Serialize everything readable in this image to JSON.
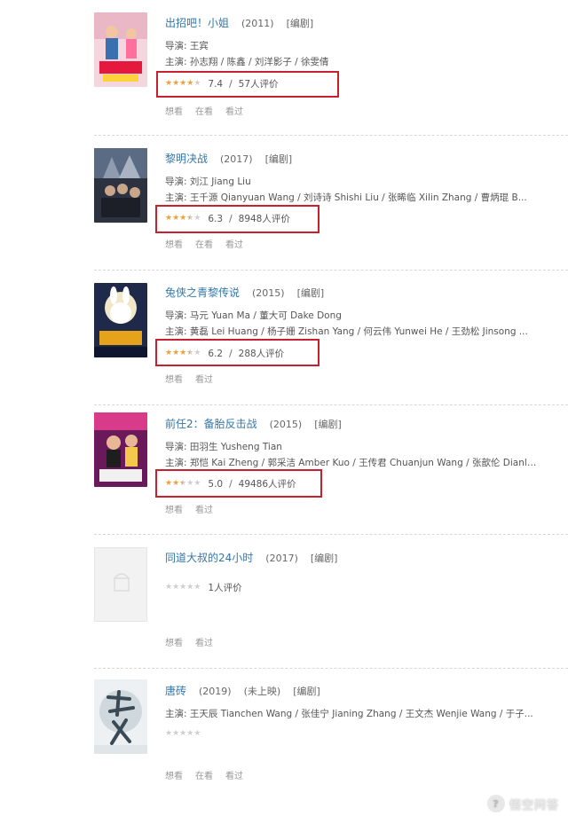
{
  "labels": {
    "director": "导演:",
    "cast": "主演:",
    "edit": "[编剧]",
    "separator": "/"
  },
  "movies": [
    {
      "title": "出招吧！小姐",
      "year": "(2011)",
      "director": "王宾",
      "cast": "孙志翔 / 陈鑫 / 刘洋影子 / 徐雯倩",
      "score": "7.4",
      "votes": "57人评价",
      "actions": [
        "想看",
        "在看",
        "看过"
      ],
      "stars": 4
    },
    {
      "title": "黎明决战",
      "year": "(2017)",
      "director": "刘江 Jiang Liu",
      "cast": "王千源 Qianyuan Wang / 刘诗诗 Shishi Liu / 张晞临 Xilin Zhang / 曹炳琨 B...",
      "score": "6.3",
      "votes": "8948人评价",
      "actions": [
        "想看",
        "在看",
        "看过"
      ],
      "stars": 3.5
    },
    {
      "title": "兔侠之青黎传说",
      "year": "(2015)",
      "director": "马元 Yuan Ma / 董大可 Dake Dong",
      "cast": "黄磊 Lei Huang / 杨子姗 Zishan Yang / 何云伟 Yunwei He / 王劲松 Jinsong ...",
      "score": "6.2",
      "votes": "288人评价",
      "actions": [
        "想看",
        "看过"
      ],
      "stars": 3.5
    },
    {
      "title": "前任2：备胎反击战",
      "year": "(2015)",
      "director": "田羽生 Yusheng Tian",
      "cast": "郑恺 Kai Zheng / 郭采洁 Amber Kuo / 王传君 Chuanjun Wang / 张歆伦 Dianlu...",
      "score": "5.0",
      "votes": "49486人评价",
      "actions": [
        "想看",
        "看过"
      ],
      "stars": 2.5
    },
    {
      "title": "同道大叔的24小时",
      "year": "(2017)",
      "votes": "1人评价",
      "actions": [
        "想看",
        "看过"
      ],
      "stars": 0
    },
    {
      "title": "唐砖",
      "year": "(2019)",
      "status": "(未上映)",
      "cast": "王天辰 Tianchen Wang / 张佳宁 Jianing Zhang / 王文杰 Wenjie Wang / 于子...",
      "actions": [
        "想看",
        "在看",
        "看过"
      ],
      "stars": 0
    }
  ],
  "watermark": {
    "text": "悟空问答"
  },
  "colors": {
    "link": "#3377aa",
    "star": "#f2a13a",
    "highlight_box": "#c8202f"
  }
}
